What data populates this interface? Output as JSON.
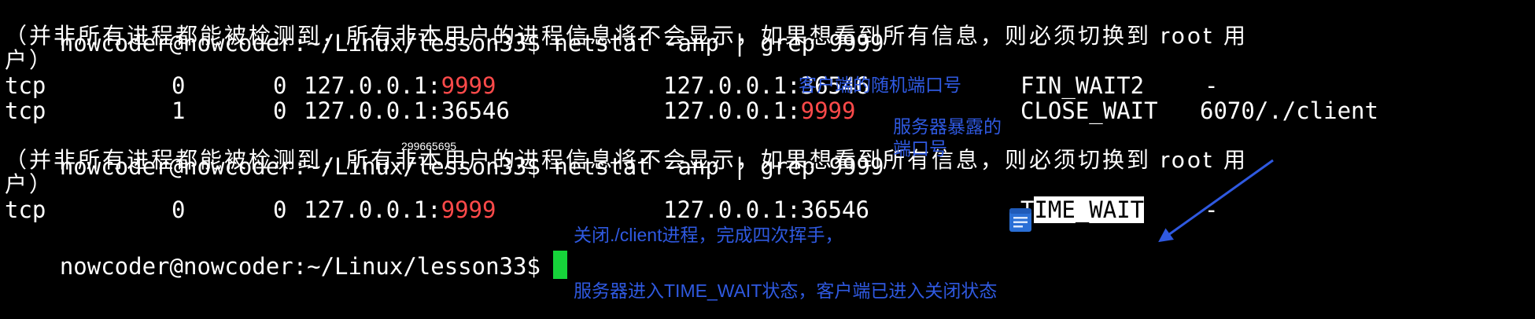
{
  "terminal": {
    "prompt": "nowcoder@nowcoder:~/Linux/lesson33$",
    "command": " netstat -anp | grep 9999",
    "notice_line1": "（并非所有进程都能被检测到，所有非本用户的进程信息将不会显示，如果想看到所有信息，则必须切换到 root 用",
    "notice_line2": "户）",
    "rows1": [
      {
        "proto": "tcp",
        "recv": "0",
        "send": "0",
        "local_ip": "127.0.0.1:",
        "local_port": "9999",
        "foreign_ip": "127.0.0.1:",
        "foreign_port": "36546",
        "state": "FIN_WAIT2",
        "pid": "-"
      },
      {
        "proto": "tcp",
        "recv": "1",
        "send": "0",
        "local_ip": "127.0.0.1:",
        "local_port": "36546",
        "foreign_ip": "127.0.0.1:",
        "foreign_port": "9999",
        "state": "CLOSE_WAIT",
        "pid": "6070/./client"
      }
    ],
    "row3": {
      "proto": "tcp",
      "recv": "0",
      "send": "0",
      "local_ip": "127.0.0.1:",
      "local_port": "9999",
      "foreign_ip": "127.0.0.1:",
      "foreign_port": "36546",
      "state_first": "T",
      "state_rest": "IME_WAIT",
      "pid": "-"
    },
    "small_number": "299665695"
  },
  "annotations": {
    "client_port": "客户端的随机端口号",
    "server_port": "服务器暴露的\n端口号",
    "close_client": "关闭./client进程，完成四次挥手，",
    "server_state": "服务器进入TIME_WAIT状态，客户端已进入关闭状态"
  },
  "icons": {
    "note": "note-icon",
    "arrow": "arrow-icon"
  },
  "colors": {
    "terminal_bg": "#000000",
    "text": "#ffffff",
    "port_highlight": "#ff4a4a",
    "annotation": "#2f59e0",
    "cursor": "#16d33a"
  }
}
